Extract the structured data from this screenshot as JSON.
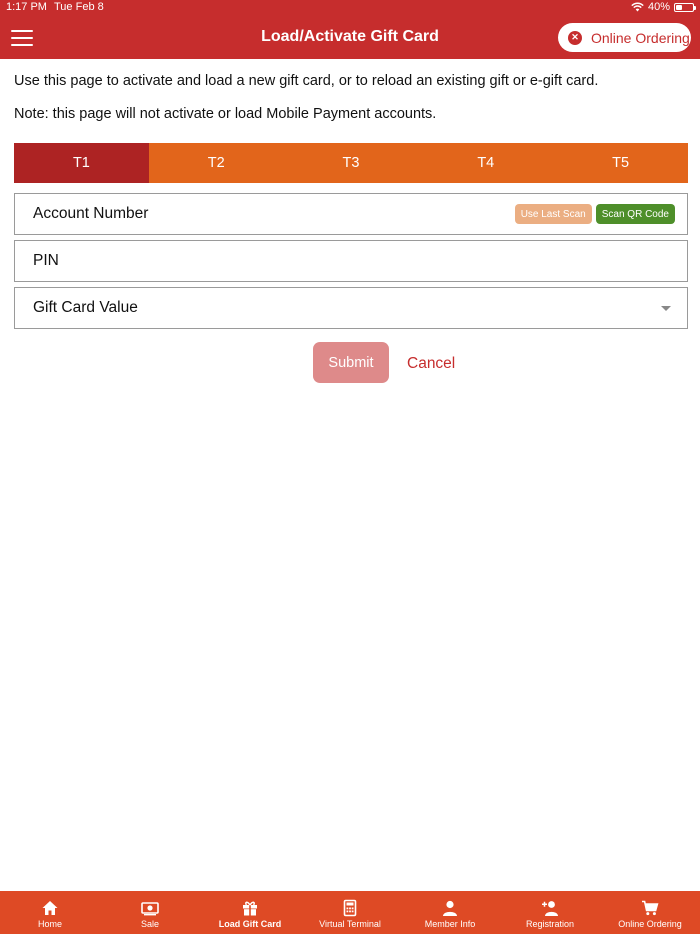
{
  "status_bar": {
    "time": "1:17 PM",
    "date": "Tue Feb 8",
    "battery": "40%",
    "battery_level": 0.4
  },
  "header": {
    "title": "Load/Activate Gift Card",
    "online_ordering_label": "Online Ordering"
  },
  "intro": {
    "text": "Use this page to activate and load a new gift card, or to reload an existing gift or e-gift card.",
    "note": "Note: this page will not activate or load Mobile Payment accounts."
  },
  "tabs": [
    {
      "label": "T1",
      "active": true
    },
    {
      "label": "T2",
      "active": false
    },
    {
      "label": "T3",
      "active": false
    },
    {
      "label": "T4",
      "active": false
    },
    {
      "label": "T5",
      "active": false
    }
  ],
  "form": {
    "account_number_placeholder": "Account Number",
    "use_last_scan_label": "Use Last Scan",
    "scan_qr_label": "Scan QR Code",
    "pin_placeholder": "PIN",
    "gift_card_value_placeholder": "Gift Card Value",
    "submit_label": "Submit",
    "cancel_label": "Cancel"
  },
  "bottom_nav": [
    {
      "label": "Home",
      "icon": "home-icon",
      "active": false
    },
    {
      "label": "Sale",
      "icon": "money-icon",
      "active": false
    },
    {
      "label": "Load Gift Card",
      "icon": "gift-icon",
      "active": true
    },
    {
      "label": "Virtual Terminal",
      "icon": "calculator-icon",
      "active": false
    },
    {
      "label": "Member Info",
      "icon": "person-icon",
      "active": false
    },
    {
      "label": "Registration",
      "icon": "add-person-icon",
      "active": false
    },
    {
      "label": "Online Ordering",
      "icon": "cart-icon",
      "active": false
    }
  ],
  "colors": {
    "header": "#c62d2d",
    "tab_bar": "#e2651b",
    "tab_active": "#ad2323",
    "bottom_nav": "#de4a25",
    "scan_last": "#ebae82",
    "scan_qr": "#4e8f2a",
    "submit": "#de8a8a"
  }
}
